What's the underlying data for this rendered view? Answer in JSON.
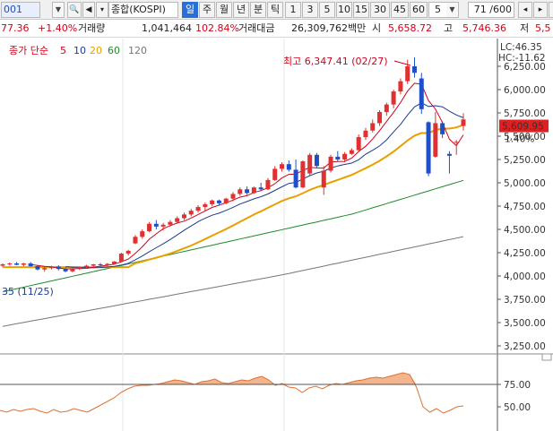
{
  "toolbar": {
    "code": "001",
    "name": "종합(KOSPI)",
    "period_tabs": [
      "일",
      "주",
      "월",
      "년",
      "분",
      "틱"
    ],
    "selected_period": "일",
    "interval_buttons": [
      "1",
      "3",
      "5",
      "10",
      "15",
      "30",
      "45",
      "60"
    ],
    "interval_dropdown": "5",
    "page_counter": "71 /600"
  },
  "quote_bar": {
    "price": "77.36",
    "change_pct": "+1.40%",
    "volume_label": "거래량",
    "volume": "1,041,464",
    "volume_ratio": "102.84%",
    "amount_label": "거래대금",
    "amount": "26,309,762백만",
    "open_label": "시",
    "open": "5,658.72",
    "high_label": "고",
    "high": "5,746.36",
    "low_label": "저",
    "low": "5,5"
  },
  "legend": {
    "title": "종가 단순",
    "periods": [
      "5",
      "10",
      "20",
      "60",
      "120"
    ],
    "colors": [
      "#d0021b",
      "#1d3c8f",
      "#e8a000",
      "#1e8a2c",
      "#777777"
    ]
  },
  "annotations": {
    "high_label": "최고 6,347.41 (02/27)",
    "low_label": "35 (11/25)",
    "lc_label": "LC:46.35",
    "hc_label": "HC:-11.62",
    "current_price": "5,609.95",
    "current_pct": "1.40%"
  },
  "colors": {
    "up": "#e03030",
    "down": "#1f4fc8",
    "price_box": "#e02020",
    "osc_fill": "#f4b48c",
    "osc_line": "#e07030"
  },
  "chart_data": {
    "type": "candlestick",
    "y_axis": {
      "ticks": [
        "6,250.00",
        "6,000.00",
        "5,750.00",
        "5,500.00",
        "5,250.00",
        "5,000.00",
        "4,750.00",
        "4,500.00",
        "4,250.00",
        "4,000.00",
        "3,750.00",
        "3,500.00",
        "3,250.00"
      ],
      "range": [
        3180,
        6380
      ]
    },
    "candles": [
      {
        "o": 4110,
        "h": 4135,
        "l": 4095,
        "c": 4125
      },
      {
        "o": 4125,
        "h": 4145,
        "l": 4110,
        "c": 4135
      },
      {
        "o": 4135,
        "h": 4150,
        "l": 4115,
        "c": 4120
      },
      {
        "o": 4120,
        "h": 4140,
        "l": 4105,
        "c": 4135
      },
      {
        "o": 4135,
        "h": 4150,
        "l": 4100,
        "c": 4105
      },
      {
        "o": 4105,
        "h": 4115,
        "l": 4060,
        "c": 4070
      },
      {
        "o": 4070,
        "h": 4095,
        "l": 4045,
        "c": 4085
      },
      {
        "o": 4085,
        "h": 4110,
        "l": 4070,
        "c": 4100
      },
      {
        "o": 4100,
        "h": 4115,
        "l": 4060,
        "c": 4075
      },
      {
        "o": 4075,
        "h": 4090,
        "l": 4040,
        "c": 4050
      },
      {
        "o": 4050,
        "h": 4085,
        "l": 4040,
        "c": 4080
      },
      {
        "o": 4080,
        "h": 4100,
        "l": 4065,
        "c": 4095
      },
      {
        "o": 4095,
        "h": 4120,
        "l": 4080,
        "c": 4110
      },
      {
        "o": 4110,
        "h": 4130,
        "l": 4095,
        "c": 4125
      },
      {
        "o": 4125,
        "h": 4140,
        "l": 4110,
        "c": 4115
      },
      {
        "o": 4115,
        "h": 4140,
        "l": 4105,
        "c": 4130
      },
      {
        "o": 4130,
        "h": 4160,
        "l": 4120,
        "c": 4155
      },
      {
        "o": 4155,
        "h": 4250,
        "l": 4150,
        "c": 4240
      },
      {
        "o": 4240,
        "h": 4280,
        "l": 4220,
        "c": 4270
      },
      {
        "o": 4350,
        "h": 4440,
        "l": 4340,
        "c": 4420
      },
      {
        "o": 4420,
        "h": 4500,
        "l": 4400,
        "c": 4480
      },
      {
        "o": 4480,
        "h": 4580,
        "l": 4470,
        "c": 4560
      },
      {
        "o": 4560,
        "h": 4600,
        "l": 4500,
        "c": 4530
      },
      {
        "o": 4530,
        "h": 4570,
        "l": 4490,
        "c": 4550
      },
      {
        "o": 4550,
        "h": 4600,
        "l": 4530,
        "c": 4580
      },
      {
        "o": 4580,
        "h": 4640,
        "l": 4560,
        "c": 4620
      },
      {
        "o": 4620,
        "h": 4680,
        "l": 4600,
        "c": 4660
      },
      {
        "o": 4660,
        "h": 4720,
        "l": 4640,
        "c": 4700
      },
      {
        "o": 4700,
        "h": 4760,
        "l": 4680,
        "c": 4740
      },
      {
        "o": 4740,
        "h": 4790,
        "l": 4700,
        "c": 4770
      },
      {
        "o": 4770,
        "h": 4820,
        "l": 4750,
        "c": 4810
      },
      {
        "o": 4810,
        "h": 4820,
        "l": 4760,
        "c": 4780
      },
      {
        "o": 4780,
        "h": 4840,
        "l": 4770,
        "c": 4830
      },
      {
        "o": 4830,
        "h": 4900,
        "l": 4800,
        "c": 4880
      },
      {
        "o": 4880,
        "h": 4950,
        "l": 4860,
        "c": 4930
      },
      {
        "o": 4930,
        "h": 4960,
        "l": 4870,
        "c": 4890
      },
      {
        "o": 4890,
        "h": 4960,
        "l": 4880,
        "c": 4950
      },
      {
        "o": 4950,
        "h": 5000,
        "l": 4910,
        "c": 4930
      },
      {
        "o": 4930,
        "h": 5050,
        "l": 4920,
        "c": 5030
      },
      {
        "o": 5030,
        "h": 5180,
        "l": 5020,
        "c": 5150
      },
      {
        "o": 5150,
        "h": 5220,
        "l": 5120,
        "c": 5200
      },
      {
        "o": 5200,
        "h": 5240,
        "l": 5120,
        "c": 5140
      },
      {
        "o": 5140,
        "h": 5250,
        "l": 4940,
        "c": 4950
      },
      {
        "o": 4950,
        "h": 5240,
        "l": 4940,
        "c": 5230
      },
      {
        "o": 5100,
        "h": 5320,
        "l": 5080,
        "c": 5300
      },
      {
        "o": 5300,
        "h": 5320,
        "l": 5160,
        "c": 5180
      },
      {
        "o": 4950,
        "h": 5180,
        "l": 4870,
        "c": 5130
      },
      {
        "o": 5130,
        "h": 5300,
        "l": 5110,
        "c": 5280
      },
      {
        "o": 5280,
        "h": 5340,
        "l": 5230,
        "c": 5250
      },
      {
        "o": 5250,
        "h": 5330,
        "l": 5220,
        "c": 5310
      },
      {
        "o": 5310,
        "h": 5370,
        "l": 5300,
        "c": 5350
      },
      {
        "o": 5350,
        "h": 5520,
        "l": 5330,
        "c": 5490
      },
      {
        "o": 5490,
        "h": 5590,
        "l": 5460,
        "c": 5560
      },
      {
        "o": 5560,
        "h": 5680,
        "l": 5540,
        "c": 5640
      },
      {
        "o": 5640,
        "h": 5780,
        "l": 5610,
        "c": 5760
      },
      {
        "o": 5760,
        "h": 5860,
        "l": 5720,
        "c": 5840
      },
      {
        "o": 5840,
        "h": 6000,
        "l": 5800,
        "c": 5980
      },
      {
        "o": 5980,
        "h": 6120,
        "l": 5950,
        "c": 6090
      },
      {
        "o": 6090,
        "h": 6320,
        "l": 6060,
        "c": 6250
      },
      {
        "o": 6250,
        "h": 6347,
        "l": 6130,
        "c": 6180
      },
      {
        "o": 6120,
        "h": 6180,
        "l": 5740,
        "c": 5790
      },
      {
        "o": 5650,
        "h": 5660,
        "l": 5070,
        "c": 5100
      },
      {
        "o": 5280,
        "h": 5760,
        "l": 5270,
        "c": 5640
      },
      {
        "o": 5640,
        "h": 5660,
        "l": 5480,
        "c": 5520
      },
      {
        "o": 5310,
        "h": 5340,
        "l": 5100,
        "c": 5290
      },
      {
        "o": 5430,
        "h": 5460,
        "l": 5300,
        "c": 5440
      },
      {
        "o": 5610,
        "h": 5746,
        "l": 5560,
        "c": 5680
      }
    ],
    "oscillator": {
      "ticks": [
        "75.00",
        "50.00"
      ],
      "values": [
        46,
        44,
        47,
        45,
        47,
        48,
        45,
        43,
        47,
        44,
        45,
        48,
        46,
        44,
        48,
        52,
        56,
        60,
        66,
        70,
        73,
        74,
        74,
        75,
        76,
        78,
        80,
        79,
        77,
        75,
        78,
        79,
        81,
        77,
        76,
        78,
        80,
        79,
        82,
        84,
        80,
        74,
        76,
        72,
        71,
        66,
        71,
        73,
        70,
        74,
        76,
        75,
        77,
        79,
        80,
        82,
        83,
        82,
        84,
        86,
        88,
        86,
        72,
        50,
        44,
        48,
        43,
        46,
        50,
        51
      ]
    }
  }
}
